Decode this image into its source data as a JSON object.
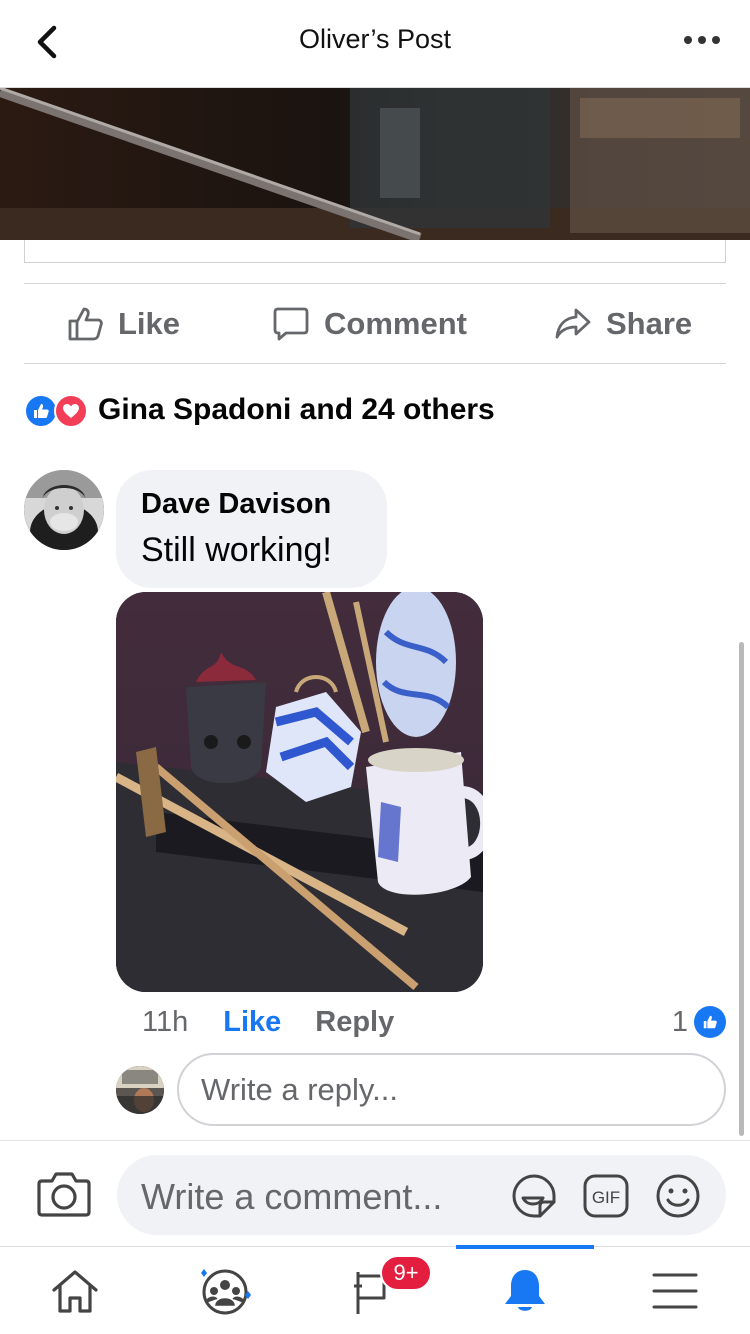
{
  "header": {
    "title": "Oliver’s Post",
    "back_icon": "chevron-left-icon",
    "more_icon": "more-dots-icon"
  },
  "actions": {
    "like_label": "Like",
    "comment_label": "Comment",
    "share_label": "Share"
  },
  "reactions": {
    "summary": "Gina Spadoni and 24 others",
    "icons": [
      "like-reaction-icon",
      "love-reaction-icon"
    ]
  },
  "comment": {
    "author": "Dave Davison",
    "text": "Still working!",
    "time": "11h",
    "like_label": "Like",
    "reply_label": "Reply",
    "like_count": "1"
  },
  "reply_box": {
    "placeholder": "Write a reply..."
  },
  "composer": {
    "placeholder": "Write a comment...",
    "gif_label": "GIF"
  },
  "bottom_nav": {
    "notifications_badge": "9+",
    "items": [
      "home-icon",
      "groups-icon",
      "pages-icon",
      "notifications-icon",
      "menu-icon"
    ],
    "active": "notifications-icon"
  },
  "colors": {
    "accent": "#1877f2",
    "love": "#f33e58",
    "badge": "#e41e3f",
    "secondary_text": "#65676b",
    "bubble_bg": "#f0f2f5"
  }
}
